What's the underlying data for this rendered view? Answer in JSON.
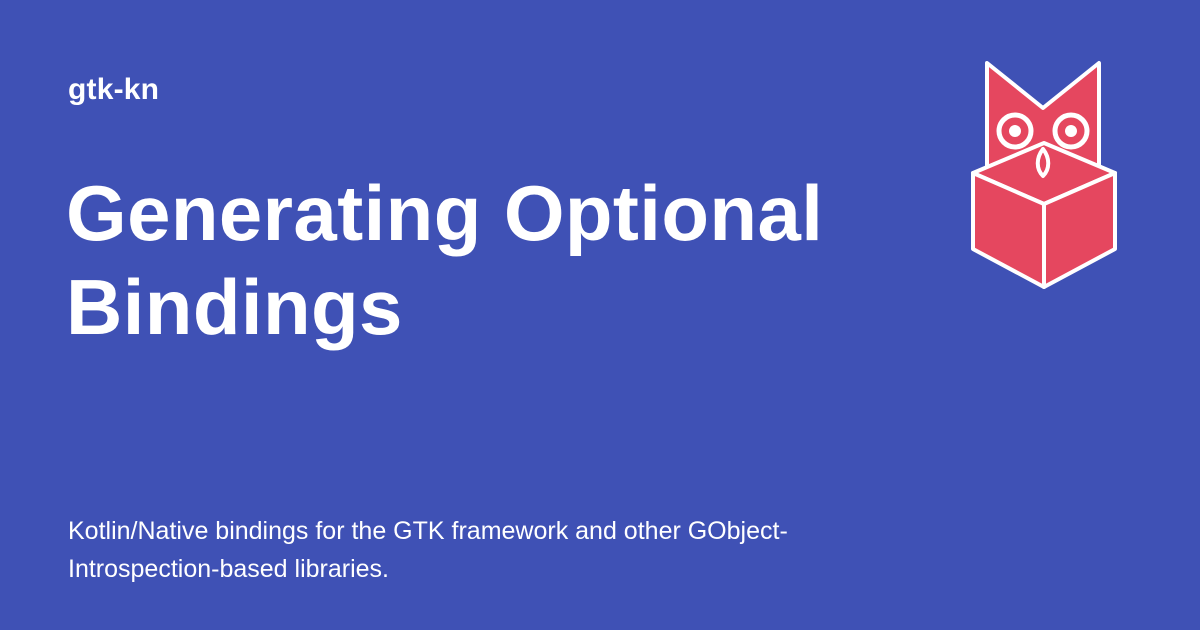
{
  "site": {
    "name": "gtk-kn"
  },
  "post": {
    "title": "Generating Optional Bindings",
    "description": "Kotlin/Native bindings for the GTK framework and other GObject-Introspection-based libraries."
  },
  "theme": {
    "background": "#3f51b5",
    "text": "#ffffff",
    "logo_fill": "#e5475f",
    "logo_outline": "#ffffff"
  },
  "logo": {
    "icon": "owl-on-cube-logo"
  }
}
